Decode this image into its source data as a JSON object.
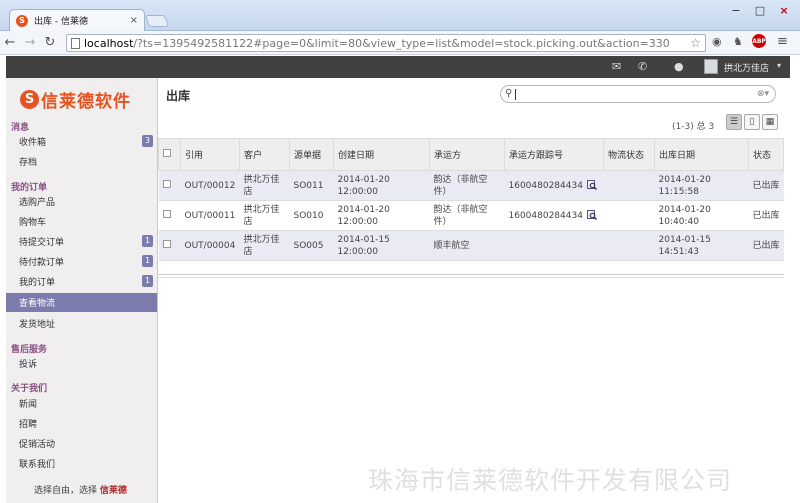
{
  "browser": {
    "tab_title": "出库 - 信莱德",
    "favicon_letter": "S",
    "tab_close": "×",
    "url_host": "localhost",
    "url_rest": "/?ts=1395492581122#page=0&limit=80&view_type=list&model=stock.picking.out&action=330",
    "window_controls": [
      "−",
      "□",
      "×"
    ],
    "abp_label": "ABP"
  },
  "topbar": {
    "user_name": "拱北万佳店"
  },
  "sidebar": {
    "logo_badge": "S",
    "logo_text": "信莱德软件",
    "sections": [
      {
        "title": "消息",
        "items": [
          {
            "label": "收件箱",
            "count": "3"
          },
          {
            "label": "存档",
            "count": ""
          }
        ]
      },
      {
        "title": "我的订单",
        "items": [
          {
            "label": "选购产品",
            "count": ""
          },
          {
            "label": "购物车",
            "count": ""
          },
          {
            "label": "待提交订单",
            "count": "1"
          },
          {
            "label": "待付款订单",
            "count": "1"
          },
          {
            "label": "我的订单",
            "count": "1"
          },
          {
            "label": "查看物流",
            "count": ""
          },
          {
            "label": "发货地址",
            "count": ""
          }
        ]
      },
      {
        "title": "售后服务",
        "items": [
          {
            "label": "投诉",
            "count": ""
          }
        ]
      },
      {
        "title": "关于我们",
        "items": [
          {
            "label": "新闻",
            "count": ""
          },
          {
            "label": "招聘",
            "count": ""
          },
          {
            "label": "促销活动",
            "count": ""
          },
          {
            "label": "联系我们",
            "count": ""
          }
        ]
      }
    ],
    "footer_text": "选择自由，选择 ",
    "footer_brand": "信莱德"
  },
  "main": {
    "title": "出库",
    "pager": "(1-3) 总 3",
    "columns": [
      "引用",
      "客户",
      "源单据",
      "创建日期",
      "承运方",
      "承运方跟踪号",
      "物流状态",
      "出库日期",
      "状态"
    ],
    "rows": [
      {
        "ref": "OUT/00012",
        "customer": "拱北万佳店",
        "source": "SO011",
        "created": "2014-01-20 12:00:00",
        "carrier": "韵达（非航空件）",
        "tracking": "1600480284434",
        "logistics": "",
        "out_date": "2014-01-20 11:15:58",
        "state": "已出库"
      },
      {
        "ref": "OUT/00011",
        "customer": "拱北万佳店",
        "source": "SO010",
        "created": "2014-01-20 12:00:00",
        "carrier": "韵达（非航空件）",
        "tracking": "1600480284434",
        "logistics": "",
        "out_date": "2014-01-20 10:40:40",
        "state": "已出库"
      },
      {
        "ref": "OUT/00004",
        "customer": "拱北万佳店",
        "source": "SO005",
        "created": "2014-01-15 12:00:00",
        "carrier": "顺丰航空",
        "tracking": "",
        "logistics": "",
        "out_date": "2014-01-15 14:51:43",
        "state": "已出库"
      }
    ]
  },
  "watermark": "珠海市信莱德软件开发有限公司"
}
